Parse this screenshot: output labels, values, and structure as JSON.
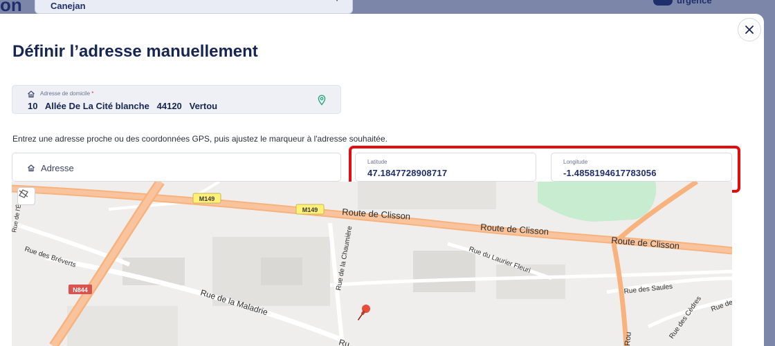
{
  "background": {
    "logo_text": "on",
    "city_select_value": "Canejan",
    "toggle_label": "urgence"
  },
  "modal": {
    "title": "Définir l’adresse manuellement",
    "close_label": "×",
    "home_address": {
      "label": "Adresse de domicile",
      "required_mark": "*",
      "value": "10   Allée De La Cité blanche   44120   Vertou"
    },
    "hint": "Entrez une adresse proche ou des coordonnées GPS, puis ajustez le marqueur à l'adresse souhaitée.",
    "address_input": {
      "placeholder": "Adresse"
    },
    "latitude": {
      "label": "Latitude",
      "value": "47.1847728908717"
    },
    "longitude": {
      "label": "Longitude",
      "value": "-1.4858194617783056"
    }
  },
  "map": {
    "road_badges": [
      "M149",
      "M149",
      "N844"
    ],
    "street_labels": [
      "Route de Clisson",
      "Route de Clisson",
      "Route de Clisson",
      "Rue des Bréverts",
      "Rue de la Maladrie",
      "Rue de la Chaumière",
      "Rue du Laurier Fleuri",
      "Rue des Saules",
      "Rue des Cèdres",
      "Rue des Orm",
      "Ru",
      "Rue de l'Éc",
      "Rou"
    ],
    "colors": {
      "major_road": "#f7b27d",
      "secondary_road": "#ffffff",
      "park": "#c8ecd0",
      "badge": "#fff07a",
      "badge_red": "#d9534f"
    }
  }
}
